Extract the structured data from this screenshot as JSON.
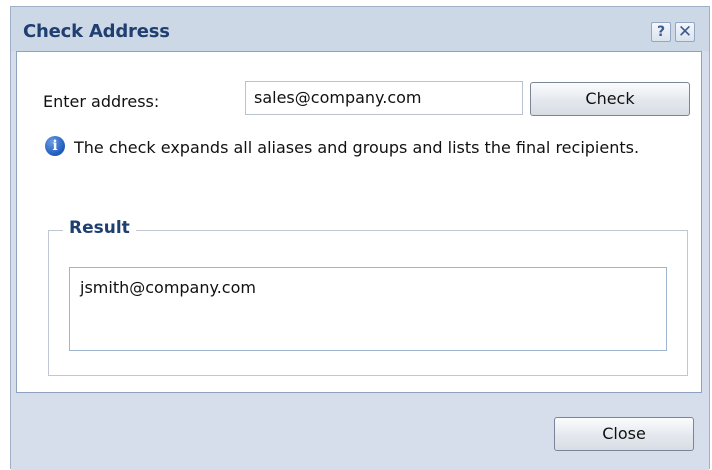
{
  "dialog": {
    "title": "Check Address",
    "help_label": "?",
    "close_label": "✕"
  },
  "form": {
    "address_label": "Enter address:",
    "address_value": "sales@company.com",
    "check_button": "Check",
    "info_text": "The check expands all aliases and groups and lists the final recipients."
  },
  "result": {
    "legend": "Result",
    "items": [
      "jsmith@company.com"
    ]
  },
  "footer": {
    "close_button": "Close"
  },
  "colors": {
    "title_text": "#1f3f70",
    "chrome": "#d5deea",
    "info_icon": "#1d5bbd"
  },
  "icons": [
    "help-icon",
    "close-icon",
    "info-icon"
  ]
}
